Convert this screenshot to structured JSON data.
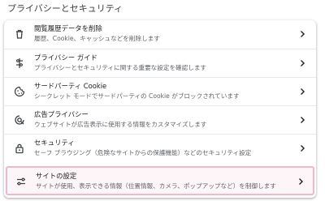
{
  "section": {
    "title": "プライバシーとセキュリティ"
  },
  "rows": [
    {
      "title": "閲覧履歴データを削除",
      "subtitle": "履歴、Cookie、キャッシュなどを削除します",
      "icon": "trash-icon"
    },
    {
      "title": "プライバシー ガイド",
      "subtitle": "プライバシーとセキュリティに関する重要な設定を確認します",
      "icon": "privacy-guide-icon"
    },
    {
      "title": "サードパーティ Cookie",
      "subtitle": "シークレット モードでサードパーティの Cookie がブロックされています",
      "icon": "cookie-icon"
    },
    {
      "title": "広告プライバシー",
      "subtitle": "ウェブサイトが広告表示に使用する情報をカスタマイズします",
      "icon": "ad-privacy-icon"
    },
    {
      "title": "セキュリティ",
      "subtitle": "セーフ ブラウジング（危険なサイトからの保護機能）などのセキュリティ設定",
      "icon": "lock-icon"
    },
    {
      "title": "サイトの設定",
      "subtitle": "サイトが使用、表示できる情報（位置情報、カメラ、ポップアップなど）を制御します",
      "icon": "site-settings-icon"
    }
  ],
  "colors": {
    "highlight_border": "#f3b5cf",
    "icon": "#3c4043",
    "subtitle": "#5f6368"
  }
}
